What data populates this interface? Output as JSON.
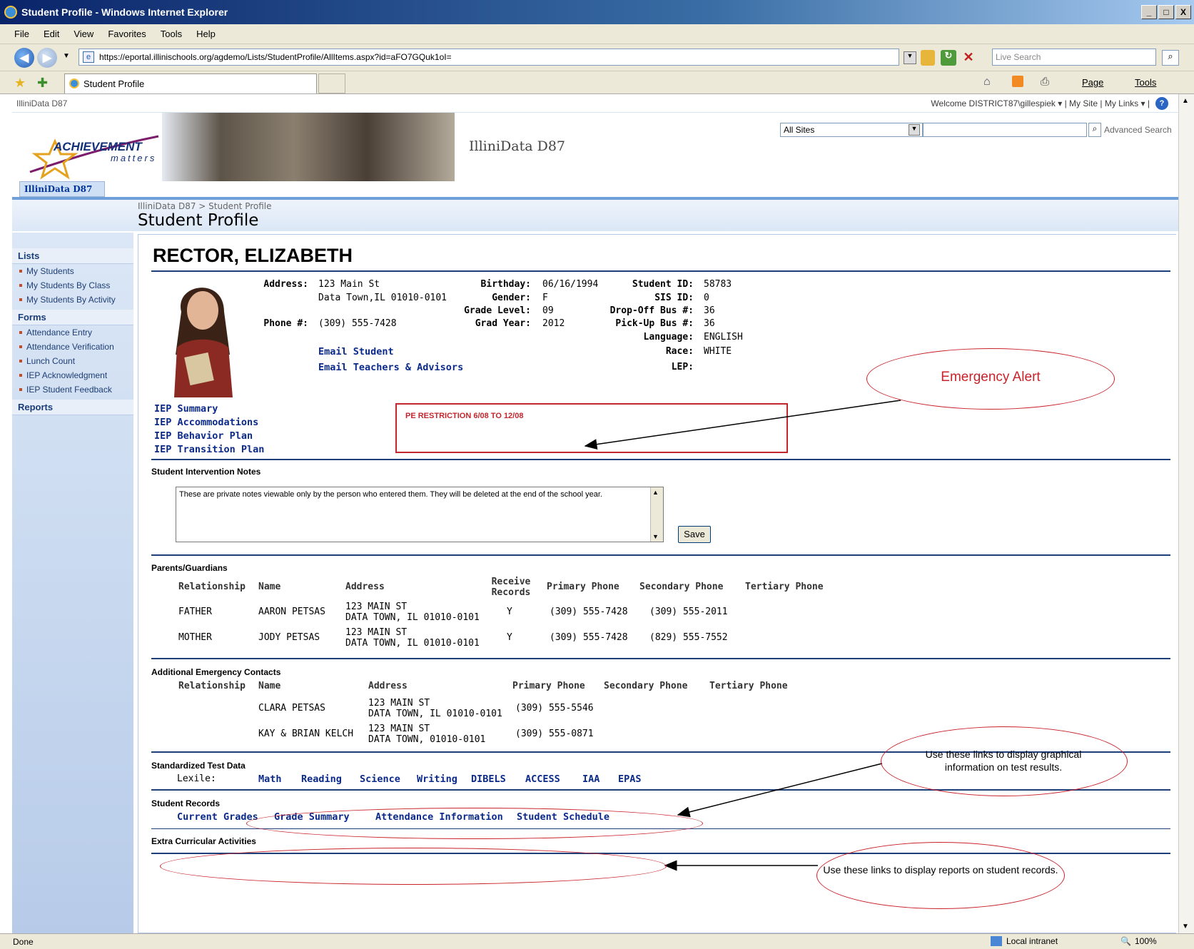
{
  "window": {
    "title": "Student Profile - Windows Internet Explorer",
    "controls": [
      "_",
      "□",
      "X"
    ]
  },
  "menu": [
    "File",
    "Edit",
    "View",
    "Favorites",
    "Tools",
    "Help"
  ],
  "address": {
    "url": "https://eportal.illinischools.org/agdemo/Lists/StudentProfile/AllItems.aspx?id=aFO7GQuk1oI=",
    "search_placeholder": "Live Search"
  },
  "favbar": {
    "tab_title": "Student Profile",
    "tools": [
      "Page",
      "Tools"
    ]
  },
  "site": {
    "top_left": "IlliniData D87",
    "welcome": "Welcome DISTRICT87\\gillespiek ▾  |  My Site  |  My Links ▾  |",
    "title": "IlliniData D87",
    "logo_main": "ACHIEVEMENT",
    "logo_sub": "matters",
    "tab": "IlliniData D87",
    "search_scope": "All Sites",
    "advanced_search": "Advanced Search",
    "breadcrumb": "IlliniData D87 > Student Profile",
    "page_title": "Student Profile"
  },
  "leftnav": {
    "lists_head": "Lists",
    "lists": [
      "My Students",
      "My Students By Class",
      "My Students By Activity"
    ],
    "forms_head": "Forms",
    "forms": [
      "Attendance Entry",
      "Attendance Verification",
      "Lunch Count",
      "IEP Acknowledgment",
      "IEP Student Feedback"
    ],
    "reports_head": "Reports"
  },
  "student": {
    "name": "RECTOR, ELIZABETH",
    "address_label": "Address:",
    "address1": "123 Main St",
    "address2": "Data Town,IL 01010-0101",
    "phone_label": "Phone #:",
    "phone": "(309) 555-7428",
    "email_student": "Email Student",
    "email_teachers": "Email Teachers & Advisors",
    "birthday_label": "Birthday:",
    "birthday": "06/16/1994",
    "gender_label": "Gender:",
    "gender": "F",
    "grade_label": "Grade Level:",
    "grade": "09",
    "gradyear_label": "Grad Year:",
    "gradyear": "2012",
    "studentid_label": "Student ID:",
    "studentid": "58783",
    "sisid_label": "SIS ID:",
    "sisid": "0",
    "dropoff_label": "Drop-Off Bus #:",
    "dropoff": "36",
    "pickup_label": "Pick-Up Bus #:",
    "pickup": "36",
    "language_label": "Language:",
    "language": "ENGLISH",
    "race_label": "Race:",
    "race": "WHITE",
    "lep_label": "LEP:",
    "lep": ""
  },
  "iep_links": [
    "IEP Summary",
    "IEP Accommodations",
    "IEP Behavior Plan",
    "IEP Transition Plan"
  ],
  "alert_text": "PE RESTRICTION 6/08 TO 12/08",
  "notes": {
    "heading": "Student Intervention Notes",
    "text": "These are private notes viewable only by the person who entered them.  They will be deleted at the end of the school year.",
    "save_label": "Save"
  },
  "parents": {
    "heading": "Parents/Guardians",
    "columns": [
      "Relationship",
      "Name",
      "Address",
      "Receive Records",
      "Primary Phone",
      "Secondary Phone",
      "Tertiary Phone"
    ],
    "rows": [
      {
        "relationship": "FATHER",
        "name": "AARON PETSAS",
        "addr1": "123 MAIN ST",
        "addr2": "DATA TOWN, IL 01010-0101",
        "records": "Y",
        "primary": "(309) 555-7428",
        "secondary": "(309) 555-2011"
      },
      {
        "relationship": "MOTHER",
        "name": "JODY PETSAS",
        "addr1": "123 MAIN ST",
        "addr2": "DATA TOWN, IL 01010-0101",
        "records": "Y",
        "primary": "(309) 555-7428",
        "secondary": "(829) 555-7552"
      }
    ]
  },
  "contacts": {
    "heading": "Additional Emergency Contacts",
    "columns": [
      "Relationship",
      "Name",
      "Address",
      "Primary Phone",
      "Secondary Phone",
      "Tertiary Phone"
    ],
    "rows": [
      {
        "name": "CLARA PETSAS",
        "addr1": "123 MAIN ST",
        "addr2": "DATA TOWN, IL 01010-0101",
        "primary": "(309) 555-5546"
      },
      {
        "name": "KAY & BRIAN KELCH",
        "addr1": "123 MAIN ST",
        "addr2": "DATA TOWN, 01010-0101",
        "primary": "(309) 555-0871"
      }
    ]
  },
  "tests": {
    "heading": "Standardized Test Data",
    "lexile_label": "Lexile:",
    "links": [
      "Math",
      "Reading",
      "Science",
      "Writing",
      "DIBELS",
      "ACCESS",
      "IAA",
      "EPAS"
    ]
  },
  "records": {
    "heading": "Student Records",
    "links": [
      "Current Grades",
      "Grade Summary",
      "Attendance Information",
      "Student Schedule"
    ]
  },
  "extra_heading": "Extra Curricular Activities",
  "annotations": {
    "emergency": "Emergency Alert",
    "tests": "Use these links to display graphical information on test results.",
    "records": "Use these links to  display reports on student records."
  },
  "status": {
    "left": "Done",
    "zone": "Local intranet",
    "zoom": "100%"
  }
}
